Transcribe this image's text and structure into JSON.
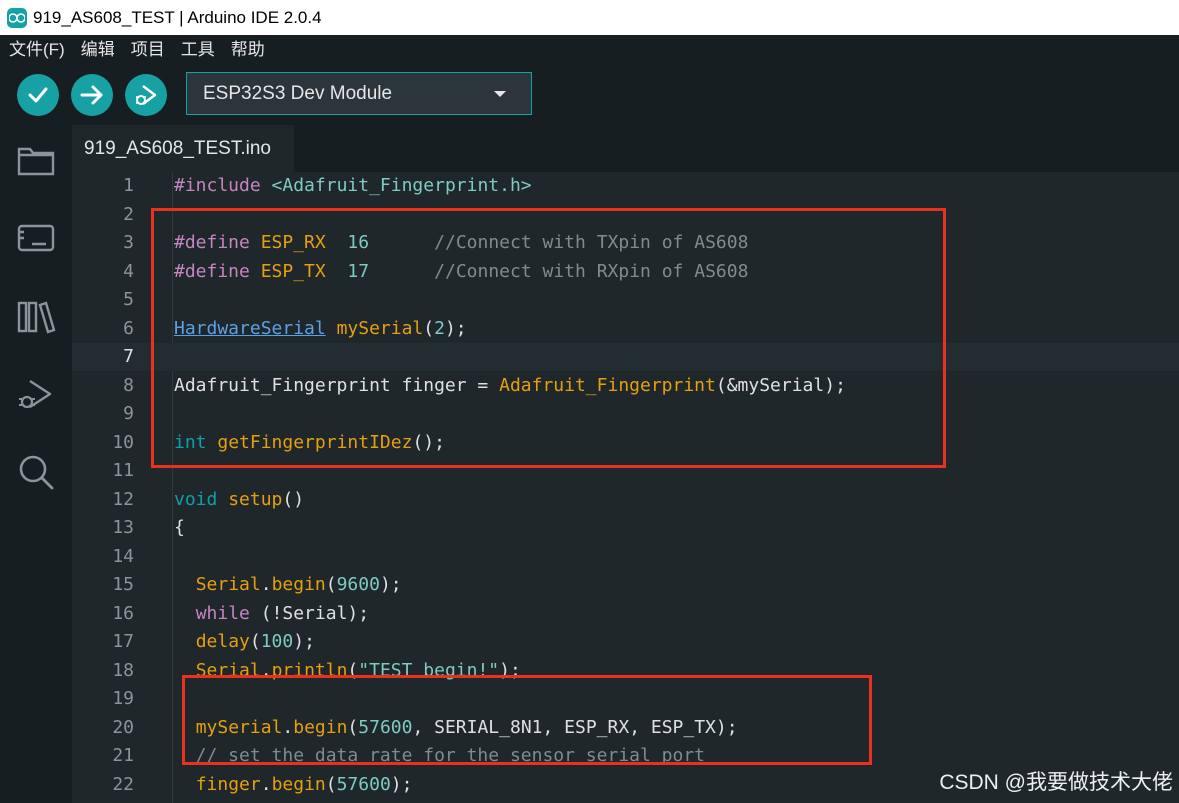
{
  "window": {
    "title": "919_AS608_TEST | Arduino IDE 2.0.4"
  },
  "menu": [
    "文件(F)",
    "编辑",
    "项目",
    "工具",
    "帮助"
  ],
  "toolbar": {
    "verify_icon": "check-icon",
    "upload_icon": "arrow-right-icon",
    "debug_icon": "debug-icon",
    "board": "ESP32S3 Dev Module"
  },
  "sidebar": {
    "icons": [
      "folder-icon",
      "board-icon",
      "library-icon",
      "debug-icon",
      "search-icon"
    ]
  },
  "tab": {
    "file": "919_AS608_TEST.ino"
  },
  "editor": {
    "current_line": 7,
    "lines": [
      {
        "n": "1",
        "t": "#include <Adafruit_Fingerprint.h>"
      },
      {
        "n": "2",
        "t": ""
      },
      {
        "n": "3",
        "t": "#define ESP_RX  16      //Connect with TXpin of AS608"
      },
      {
        "n": "4",
        "t": "#define ESP_TX  17      //Connect with RXpin of AS608"
      },
      {
        "n": "5",
        "t": ""
      },
      {
        "n": "6",
        "t": "HardwareSerial mySerial(2);"
      },
      {
        "n": "7",
        "t": ""
      },
      {
        "n": "8",
        "t": "Adafruit_Fingerprint finger = Adafruit_Fingerprint(&mySerial);"
      },
      {
        "n": "9",
        "t": ""
      },
      {
        "n": "10",
        "t": "int getFingerprintIDez();"
      },
      {
        "n": "11",
        "t": ""
      },
      {
        "n": "12",
        "t": "void setup()"
      },
      {
        "n": "13",
        "t": "{"
      },
      {
        "n": "14",
        "t": ""
      },
      {
        "n": "15",
        "t": "  Serial.begin(9600);"
      },
      {
        "n": "16",
        "t": "  while (!Serial);"
      },
      {
        "n": "17",
        "t": "  delay(100);"
      },
      {
        "n": "18",
        "t": "  Serial.println(\"TEST begin!\");"
      },
      {
        "n": "19",
        "t": ""
      },
      {
        "n": "20",
        "t": "  mySerial.begin(57600, SERIAL_8N1, ESP_RX, ESP_TX);"
      },
      {
        "n": "21",
        "t": "  // set the data rate for the sensor serial port"
      },
      {
        "n": "22",
        "t": "  finger.begin(57600);"
      }
    ]
  },
  "watermark": "CSDN @我要做技术大佬",
  "colors": {
    "accent": "#17a1a5",
    "annotation": "#e8321e",
    "editor_bg": "#1f272b",
    "chrome_bg": "#171e21"
  }
}
